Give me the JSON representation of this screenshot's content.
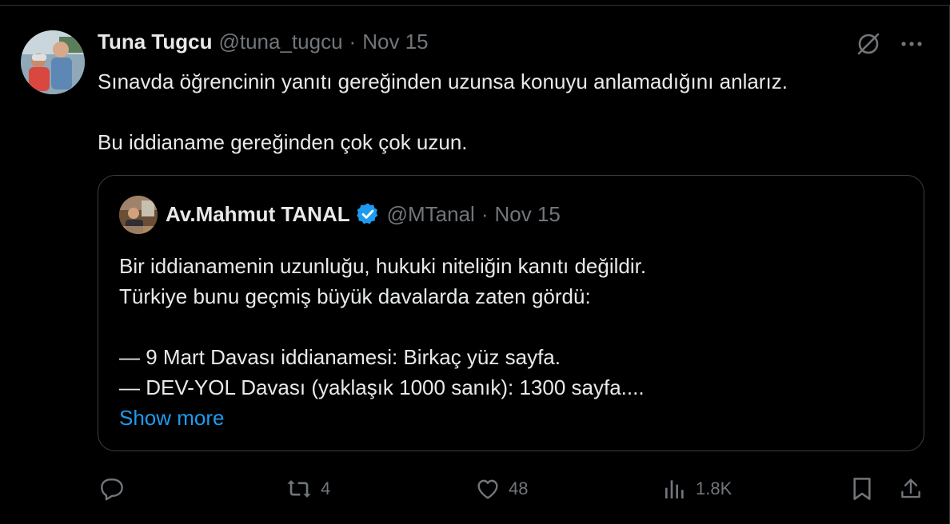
{
  "tweet": {
    "author_name": "Tuna Tugcu",
    "author_handle": "@tuna_tugcu",
    "separator": "·",
    "date": "Nov 15",
    "text_line1": "Sınavda öğrencinin yanıtı gereğinden uzunsa konuyu anlamadığını anlarız.",
    "text_line2": "Bu iddianame gereğinden çok çok uzun."
  },
  "quote": {
    "author_name": "Av.Mahmut TANAL",
    "author_handle": "@MTanal",
    "separator": "·",
    "date": "Nov 15",
    "verified": true,
    "lines": [
      "Bir iddianamenin uzunluğu, hukuki niteliğin kanıtı değildir.",
      "Türkiye bunu geçmiş büyük davalarda zaten gördü:",
      "— 9 Mart Davası iddianamesi: Birkaç yüz sayfa.",
      "— DEV-YOL Davası (yaklaşık 1000 sanık): 1300 sayfa...."
    ],
    "show_more": "Show more"
  },
  "actions": {
    "reply_count": "",
    "repost_count": "4",
    "like_count": "48",
    "views_count": "1.8K"
  },
  "icons": {
    "grok": "grok-icon",
    "more": "more-icon",
    "reply": "reply-icon",
    "repost": "repost-icon",
    "like": "heart-icon",
    "views": "analytics-icon",
    "bookmark": "bookmark-icon",
    "share": "share-icon",
    "verified": "verified-badge-icon"
  },
  "colors": {
    "background": "#000000",
    "text": "#e7e9ea",
    "muted": "#71767b",
    "link": "#1d9bf0",
    "verified": "#1d9bf0",
    "border": "#2f3336"
  }
}
